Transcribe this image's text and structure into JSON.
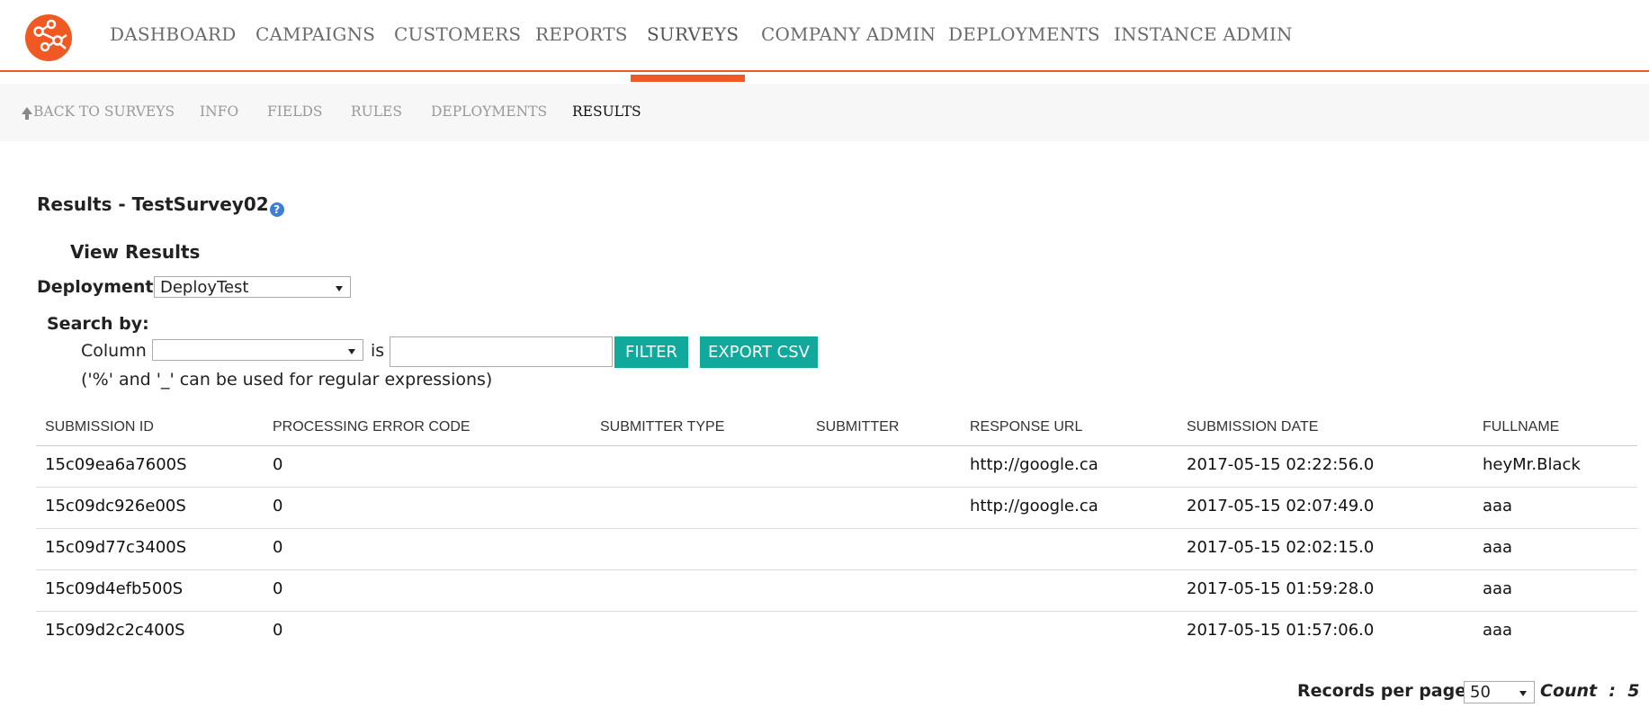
{
  "nav": {
    "items": [
      {
        "label": "DASHBOARD"
      },
      {
        "label": "CAMPAIGNS"
      },
      {
        "label": "CUSTOMERS"
      },
      {
        "label": "REPORTS"
      },
      {
        "label": "SURVEYS"
      },
      {
        "label": "COMPANY ADMIN"
      },
      {
        "label": "DEPLOYMENTS"
      },
      {
        "label": "INSTANCE ADMIN"
      }
    ],
    "active": "SURVEYS",
    "logo_icon": "network-nodes-icon"
  },
  "subnav": {
    "items": [
      {
        "label": "BACK TO SURVEYS",
        "icon": "arrow-up-icon"
      },
      {
        "label": "INFO"
      },
      {
        "label": "FIELDS"
      },
      {
        "label": "RULES"
      },
      {
        "label": "DEPLOYMENTS"
      },
      {
        "label": "RESULTS"
      }
    ],
    "active": "RESULTS"
  },
  "page": {
    "title": "Results - TestSurvey02",
    "help_icon": "?",
    "view_results": "View Results",
    "deployment_label": "Deployment:",
    "deployment_value": "DeployTest",
    "search_by": "Search by:",
    "column_label": "Column",
    "column_value": "",
    "is_label": "is",
    "filter_value": "",
    "filter_button": "FILTER",
    "export_button": "EXPORT CSV",
    "hint": "('%' and '_' can be used for regular expressions)"
  },
  "table": {
    "columns": [
      "SUBMISSION ID",
      "PROCESSING ERROR CODE",
      "SUBMITTER TYPE",
      "SUBMITTER",
      "RESPONSE URL",
      "SUBMISSION DATE",
      "FULLNAME"
    ],
    "rows": [
      [
        "15c09ea6a7600S",
        "0",
        "",
        "",
        "http://google.ca",
        "2017-05-15 02:22:56.0",
        "heyMr.Black"
      ],
      [
        "15c09dc926e00S",
        "0",
        "",
        "",
        "http://google.ca",
        "2017-05-15 02:07:49.0",
        "aaa"
      ],
      [
        "15c09d77c3400S",
        "0",
        "",
        "",
        "",
        "2017-05-15 02:02:15.0",
        "aaa"
      ],
      [
        "15c09d4efb500S",
        "0",
        "",
        "",
        "",
        "2017-05-15 01:59:28.0",
        "aaa"
      ],
      [
        "15c09d2c2c400S",
        "0",
        "",
        "",
        "",
        "2017-05-15 01:57:06.0",
        "aaa"
      ]
    ]
  },
  "footer": {
    "records_per_page_label": "Records per page",
    "records_per_page_value": "50",
    "count_label": "Count  :  5"
  },
  "colors": {
    "accent": "#f05a22",
    "button": "#11a99b",
    "help": "#3e7ed4"
  }
}
